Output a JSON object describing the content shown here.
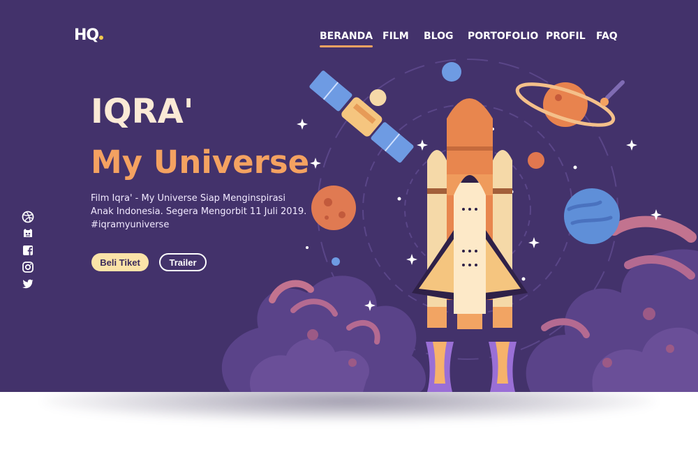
{
  "brand": {
    "logo_text": "HQ"
  },
  "nav": {
    "items": [
      {
        "label": "BERANDA",
        "active": true
      },
      {
        "label": "FILM",
        "active": false
      },
      {
        "label": "BLOG",
        "active": false
      },
      {
        "label": "PORTOFOLIO",
        "active": false
      },
      {
        "label": "PROFIL",
        "active": false
      },
      {
        "label": "FAQ",
        "active": false
      }
    ]
  },
  "hero": {
    "title": "IQRA'",
    "subtitle": "My Universe",
    "description": "Film Iqra' - My Universe Siap Menginspirasi Anak Indonesia. Segera Mengorbit 11 Juli 2019. #iqramyuniverse",
    "primary_button": "Beli Tiket",
    "secondary_button": "Trailer"
  },
  "social": [
    "dribbble-icon",
    "github-icon",
    "facebook-icon",
    "instagram-icon",
    "twitter-icon"
  ],
  "colors": {
    "background": "#43326b",
    "accent": "#f4a261",
    "title": "#fbead6",
    "button": "#fbe3a8"
  }
}
